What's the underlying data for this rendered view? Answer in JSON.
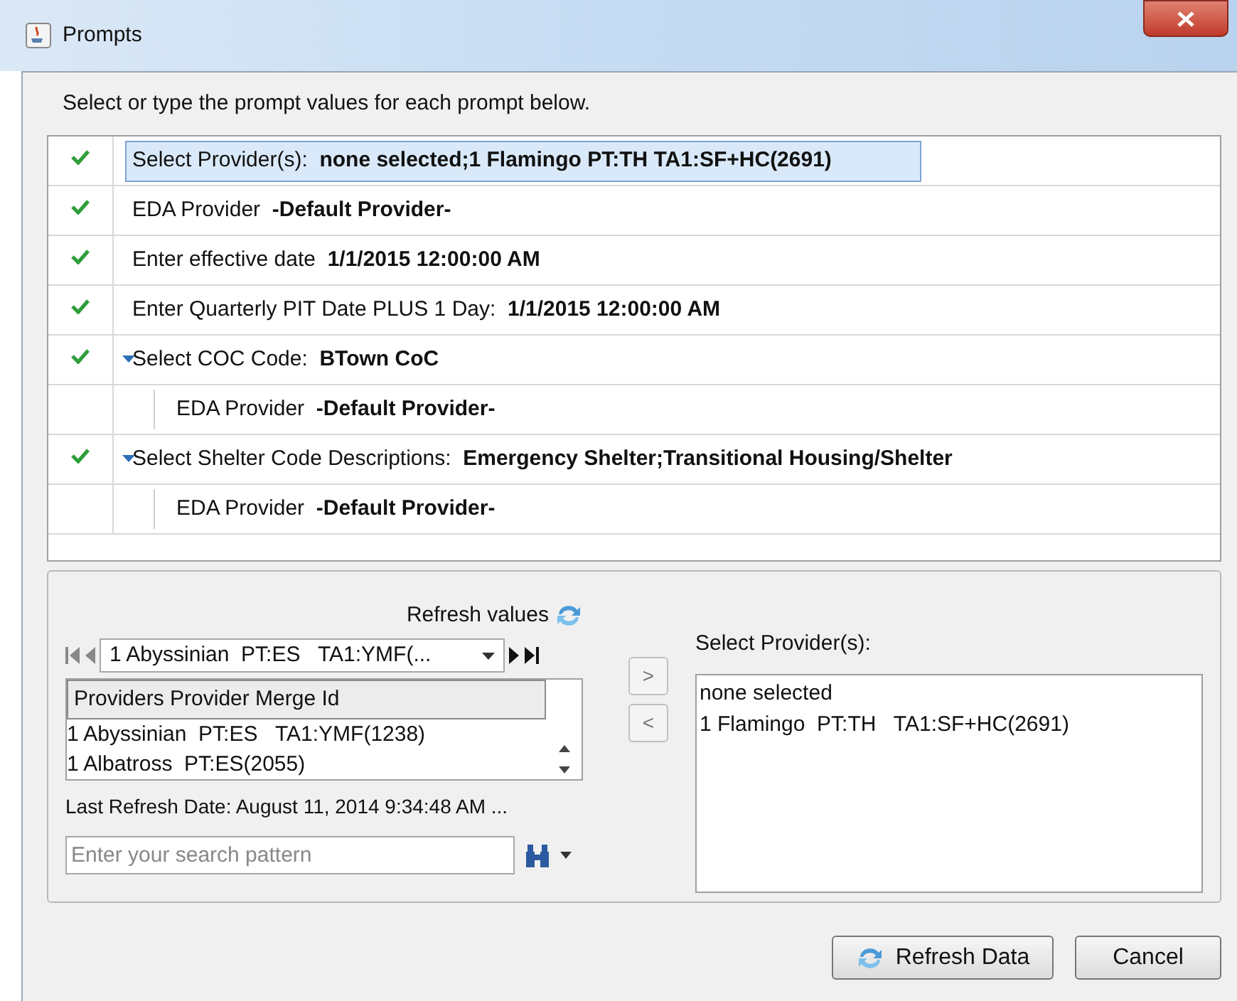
{
  "window": {
    "title": "Prompts"
  },
  "instruction": "Select or type the prompt values for each prompt below.",
  "prompts": [
    {
      "label": "Select Provider(s):",
      "value": "none selected;1 Flamingo PT:TH TA1:SF+HC(2691)",
      "checked": true,
      "selected": true
    },
    {
      "label": "EDA Provider",
      "value": "-Default Provider-",
      "checked": true,
      "selected": false
    },
    {
      "label": "Enter effective date",
      "value": "1/1/2015 12:00:00 AM",
      "checked": true,
      "selected": false
    },
    {
      "label": "Enter Quarterly PIT Date PLUS 1 Day:",
      "value": "1/1/2015 12:00:00 AM",
      "checked": true,
      "selected": false
    },
    {
      "label": "Select COC Code:",
      "value": "BTown CoC",
      "checked": true,
      "selected": false,
      "expanded": true,
      "children": [
        {
          "label": "EDA Provider",
          "value": "-Default Provider-"
        }
      ]
    },
    {
      "label": "Select Shelter Code Descriptions:",
      "value": "Emergency Shelter;Transitional Housing/Shelter",
      "checked": true,
      "selected": false,
      "expanded": true,
      "children": [
        {
          "label": "EDA Provider",
          "value": "-Default Provider-"
        }
      ]
    }
  ],
  "refresh_values": "Refresh values",
  "combo": {
    "value": "1 Abyssinian  PT:ES   TA1:YMF(..."
  },
  "table": {
    "columns": [
      "Providers Provider Merge Id"
    ],
    "rows": [
      "1 Abyssinian  PT:ES   TA1:YMF(1238)",
      "1 Albatross  PT:ES(2055)"
    ]
  },
  "last_refresh": "Last Refresh Date: August 11, 2014 9:34:48 AM ...",
  "search": {
    "placeholder": "Enter your search pattern"
  },
  "move_buttons": [
    ">",
    "<"
  ],
  "selected_list": {
    "label": "Select Provider(s):",
    "items": [
      "none selected",
      "1 Flamingo  PT:TH   TA1:SF+HC(2691)"
    ]
  },
  "buttons": [
    {
      "label": "Refresh Data",
      "kind": "refresh"
    },
    {
      "label": "Cancel",
      "kind": "plain"
    }
  ]
}
